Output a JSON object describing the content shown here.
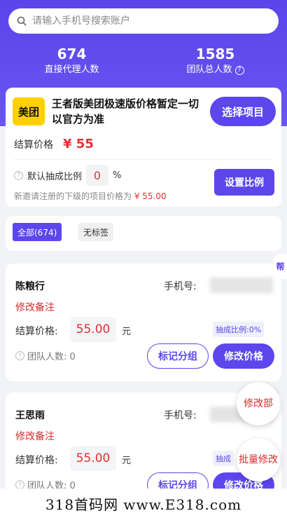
{
  "search": {
    "placeholder": "请输入手机号搜索账户"
  },
  "stats": {
    "direct_count": "674",
    "direct_label": "直接代理人数",
    "team_count": "1585",
    "team_label": "团队总人数"
  },
  "project": {
    "logo_text": "美团",
    "title": "王者版美团极速版价格暂定一切以官方为准",
    "select_label": "选择项目",
    "settle_label": "结算价格",
    "settle_price": "¥ 55",
    "ratio_label": "默认抽成比例",
    "ratio_value": "0",
    "ratio_unit": "%",
    "set_ratio_label": "设置比例",
    "hint_prefix": "新邀请注册的下级的项目价格为",
    "hint_price": "¥ 55.00"
  },
  "filters": {
    "all_label": "全部(674)",
    "untagged_label": "无标签"
  },
  "agents": [
    {
      "name": "陈粮行",
      "phone_label": "手机号:",
      "remark": "修改备注",
      "settle_label": "结算价格:",
      "price": "55.00",
      "unit": "元",
      "ratio_tag": "抽成比例:0%",
      "team_label": "团队人数: 0",
      "mark_label": "标记分组",
      "edit_label": "修改价格"
    },
    {
      "name": "王思雨",
      "phone_label": "手机号:",
      "remark": "修改备注",
      "settle_label": "结算价格:",
      "price": "55.00",
      "unit": "元",
      "ratio_tag": "抽成",
      "team_label": "团队人数: 0",
      "mark_label": "标记分组",
      "edit_label": "修改价格"
    }
  ],
  "floating": {
    "help": "帮",
    "modify_part": "修改部",
    "batch_modify": "批量修改"
  },
  "watermark": "318首码网 www.E318.com",
  "colors": {
    "accent": "#5c46ec",
    "price_red": "#e53030",
    "header_bg": "#5b45ea"
  }
}
